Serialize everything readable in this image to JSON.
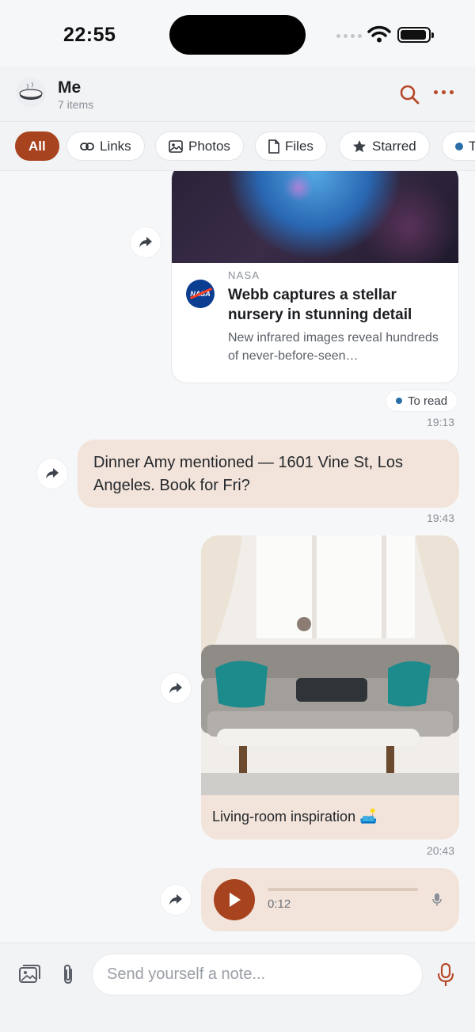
{
  "status_bar": {
    "time": "22:55"
  },
  "header": {
    "title": "Me",
    "subtitle": "7 items"
  },
  "filters": [
    {
      "label": "All",
      "icon": "none",
      "active": true
    },
    {
      "label": "Links",
      "icon": "link-icon"
    },
    {
      "label": "Photos",
      "icon": "image-icon"
    },
    {
      "label": "Files",
      "icon": "file-icon"
    },
    {
      "label": "Starred",
      "icon": "star-icon"
    },
    {
      "label": "T",
      "icon": "blue-dot-icon"
    }
  ],
  "messages": {
    "link": {
      "source": "NASA",
      "headline": "Webb captures a stellar nursery in stunning detail",
      "summary": "New infrared images reveal hundreds of never-before-seen…",
      "tag": "To read",
      "time": "19:13"
    },
    "note": {
      "text": "Dinner Amy mentioned — 1601 Vine St, Los Angeles. Book for Fri?",
      "time": "19:43"
    },
    "photo": {
      "caption": "Living-room inspiration 🛋️",
      "time": "20:43"
    },
    "audio": {
      "duration": "0:12"
    }
  },
  "composer": {
    "placeholder": "Send yourself a note..."
  },
  "colors": {
    "accent": "#a8431f",
    "bubble": "#f2e4da",
    "tag_dot": "#2a6ea8"
  }
}
